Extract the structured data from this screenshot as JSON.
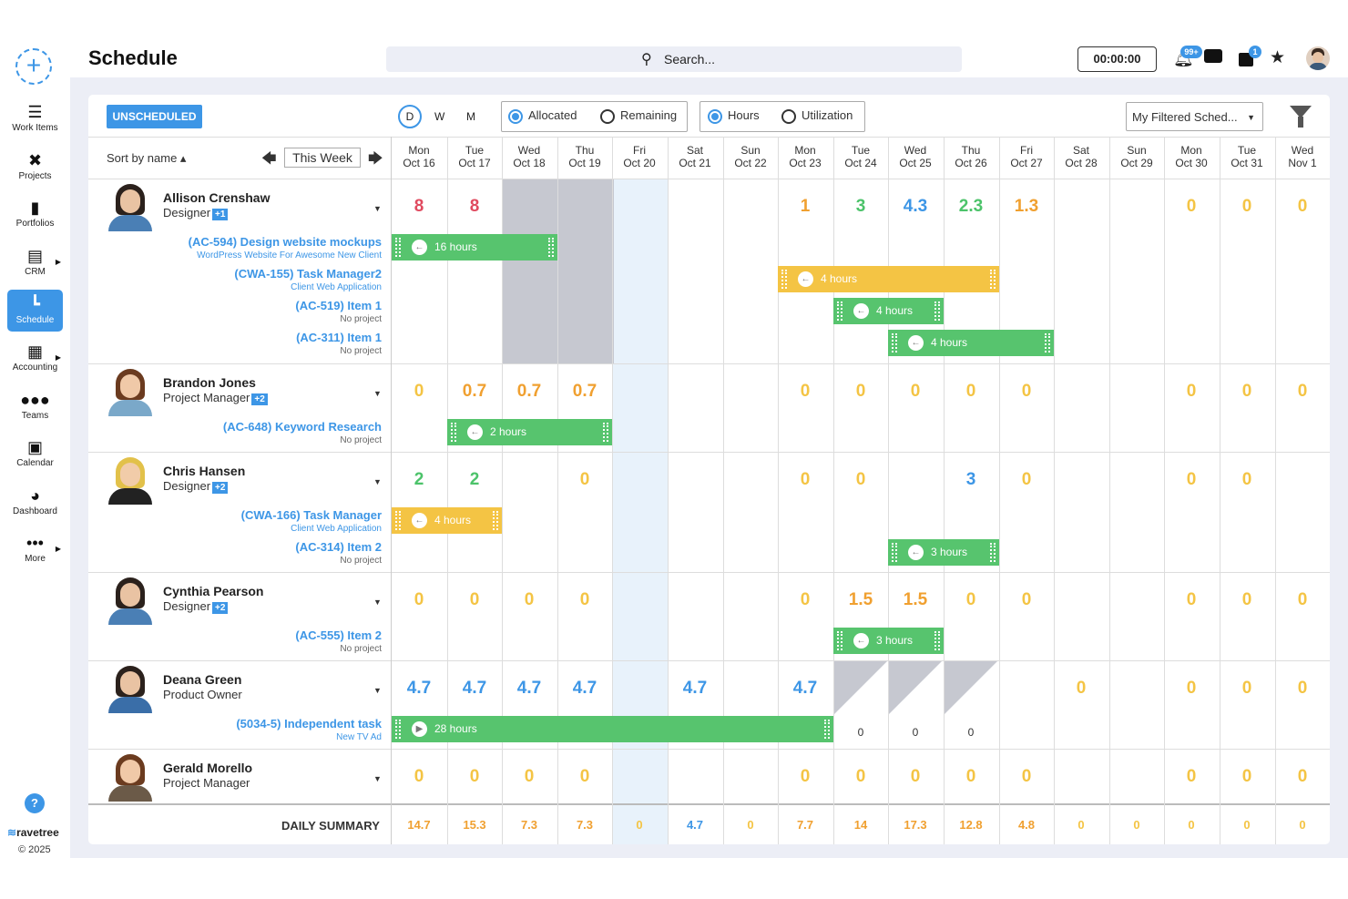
{
  "colors": {
    "accent": "#3d96e6",
    "red": "#e04a5f",
    "orange": "#f0a030",
    "green": "#4cc36a",
    "blue": "#3d96e6",
    "bar_green": "#57c46e",
    "bar_yellow": "#f4c444",
    "weekend": "#c6c8d0",
    "today": "#e8f2fb"
  },
  "sidebar": {
    "add_icon": "plus-circle-icon",
    "items": [
      {
        "label": "Work Items",
        "icon": "checklist-icon"
      },
      {
        "label": "Projects",
        "icon": "tools-icon"
      },
      {
        "label": "Portfolios",
        "icon": "briefcase-icon"
      },
      {
        "label": "CRM",
        "icon": "contact-card-icon"
      },
      {
        "label": "Schedule",
        "icon": "gantt-icon"
      },
      {
        "label": "Accounting",
        "icon": "receipt-icon"
      },
      {
        "label": "Teams",
        "icon": "team-icon"
      },
      {
        "label": "Calendar",
        "icon": "calendar-icon"
      },
      {
        "label": "Dashboard",
        "icon": "gauge-icon"
      },
      {
        "label": "More",
        "icon": "ellipsis-icon"
      }
    ],
    "help": "?",
    "brand": "ravetree",
    "copyright": "© 2025"
  },
  "header": {
    "title": "Schedule",
    "search_placeholder": "Search...",
    "timer": "00:00:00",
    "notifications_badge": "99+",
    "inbox_badge": "1"
  },
  "toolbar": {
    "unscheduled": "UNSCHEDULED",
    "views": [
      "D",
      "W",
      "M"
    ],
    "allocated": "Allocated",
    "remaining": "Remaining",
    "hours": "Hours",
    "utilization": "Utilization",
    "filter_select": "My Filtered Sched..."
  },
  "grid": {
    "sort_label": "Sort by name ▴",
    "week_label": "This Week",
    "days": [
      {
        "dow": "Mon",
        "date": "Oct 16"
      },
      {
        "dow": "Tue",
        "date": "Oct 17"
      },
      {
        "dow": "Wed",
        "date": "Oct 18"
      },
      {
        "dow": "Thu",
        "date": "Oct 19"
      },
      {
        "dow": "Fri",
        "date": "Oct 20"
      },
      {
        "dow": "Sat",
        "date": "Oct 21"
      },
      {
        "dow": "Sun",
        "date": "Oct 22"
      },
      {
        "dow": "Mon",
        "date": "Oct 23"
      },
      {
        "dow": "Tue",
        "date": "Oct 24"
      },
      {
        "dow": "Wed",
        "date": "Oct 25"
      },
      {
        "dow": "Thu",
        "date": "Oct 26"
      },
      {
        "dow": "Fri",
        "date": "Oct 27"
      },
      {
        "dow": "Sat",
        "date": "Oct 28"
      },
      {
        "dow": "Sun",
        "date": "Oct 29"
      },
      {
        "dow": "Mon",
        "date": "Oct 30"
      },
      {
        "dow": "Tue",
        "date": "Oct 31"
      },
      {
        "dow": "Wed",
        "date": "Nov 1"
      }
    ],
    "people": [
      {
        "name": "Allison Crenshaw",
        "role": "Designer",
        "plus": "+1",
        "tasks": [
          {
            "title": "(AC-594) Design website mockups",
            "sub": "WordPress Website For Awesome New Client"
          },
          {
            "title": "(CWA-155) Task Manager2",
            "sub": "Client Web Application"
          },
          {
            "title": "(AC-519) Item 1",
            "sub": "No project"
          },
          {
            "title": "(AC-311) Item 1",
            "sub": "No project"
          }
        ],
        "values": [
          "8",
          "8",
          "",
          "",
          "",
          "",
          "",
          "1",
          "3",
          "4.3",
          "2.3",
          "1.3",
          "",
          "",
          "0",
          "0",
          "0"
        ],
        "bars": [
          "16 hours",
          "4 hours",
          "4 hours",
          "4 hours"
        ]
      },
      {
        "name": "Brandon Jones",
        "role": "Project Manager",
        "plus": "+2",
        "tasks": [
          {
            "title": "(AC-648) Keyword Research",
            "sub": "No project"
          }
        ],
        "values": [
          "0",
          "0.7",
          "0.7",
          "0.7",
          "",
          "",
          "",
          "0",
          "0",
          "0",
          "0",
          "0",
          "",
          "",
          "0",
          "0",
          "0"
        ],
        "bars": [
          "2 hours"
        ]
      },
      {
        "name": "Chris Hansen",
        "role": "Designer",
        "plus": "+2",
        "tasks": [
          {
            "title": "(CWA-166) Task Manager",
            "sub": "Client Web Application"
          },
          {
            "title": "(AC-314) Item 2",
            "sub": "No project"
          }
        ],
        "values": [
          "2",
          "2",
          "",
          "0",
          "",
          "",
          "",
          "0",
          "0",
          "",
          "3",
          "0",
          "",
          "",
          "0",
          "0",
          ""
        ],
        "bars": [
          "4 hours",
          "3 hours"
        ]
      },
      {
        "name": "Cynthia Pearson",
        "role": "Designer",
        "plus": "+2",
        "tasks": [
          {
            "title": "(AC-555) Item 2",
            "sub": "No project"
          }
        ],
        "values": [
          "0",
          "0",
          "0",
          "0",
          "",
          "",
          "",
          "0",
          "1.5",
          "1.5",
          "0",
          "0",
          "",
          "",
          "0",
          "0",
          "0"
        ],
        "bars": [
          "3 hours"
        ]
      },
      {
        "name": "Deana Green",
        "role": "Product Owner",
        "plus": "",
        "tasks": [
          {
            "title": "(5034-5) Independent task",
            "sub": "New TV Ad"
          }
        ],
        "values": [
          "4.7",
          "4.7",
          "4.7",
          "4.7",
          "",
          "4.7",
          "",
          "4.7",
          "",
          "",
          "",
          "",
          "0",
          "",
          "0",
          "0",
          "0"
        ],
        "small_values": [
          "0",
          "0",
          "0"
        ],
        "bars": [
          "28 hours"
        ]
      },
      {
        "name": "Gerald Morello",
        "role": "Project Manager",
        "plus": "",
        "tasks": [],
        "values": [
          "0",
          "0",
          "0",
          "0",
          "",
          "",
          "",
          "0",
          "0",
          "0",
          "0",
          "0",
          "",
          "",
          "0",
          "0",
          "0"
        ],
        "bars": []
      }
    ],
    "summary_label": "DAILY SUMMARY",
    "summary": [
      "14.7",
      "15.3",
      "7.3",
      "7.3",
      "0",
      "4.7",
      "0",
      "7.7",
      "14",
      "17.3",
      "12.8",
      "4.8",
      "0",
      "0",
      "0",
      "0",
      "0"
    ]
  }
}
